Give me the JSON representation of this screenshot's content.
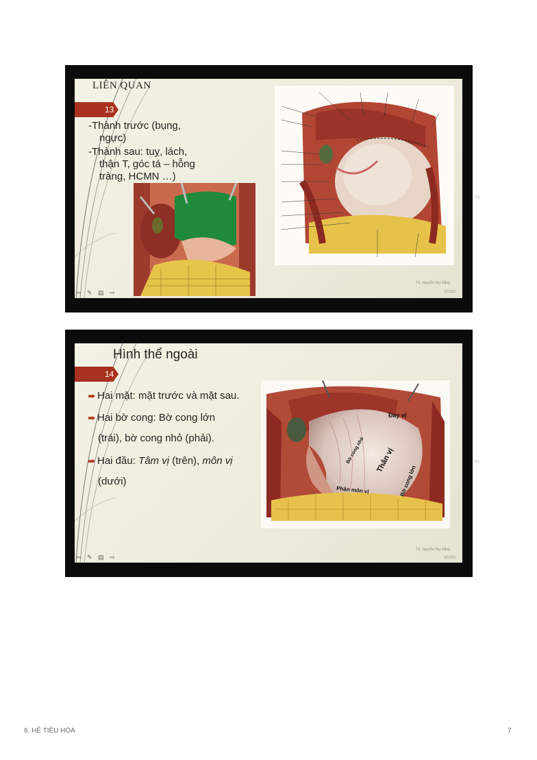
{
  "slides": [
    {
      "title": "LIÊN QUAN",
      "number": "13",
      "lines": [
        "-Thành trước (bụng,",
        "ngực)",
        "-Thành sau: tuỵ, lách,",
        "thận T, góc tá – hỗng",
        "tràng, HCMN …)"
      ],
      "credit": "TS. Nguyễn Huy Bằng",
      "date": "5/17/22",
      "edge_label": "Ng"
    },
    {
      "title": "Hình thể ngoài",
      "number": "14",
      "bullets": [
        {
          "text": "Hai mặt: mặt trước và mặt sau."
        },
        {
          "text": "Hai bờ cong: Bờ cong lớn",
          "cont": "(trái), bờ cong nhỏ  (phải)."
        },
        {
          "lead": "Hai đầu: ",
          "em1": "Tâm vị",
          "mid": " (trên), ",
          "em2": "môn vị",
          "cont": "(dưới)"
        }
      ],
      "image_labels": {
        "fundus": "Đáy vị",
        "body": "Thân vị",
        "lesser_curvature": "Bờ cong nhỏ",
        "greater_curvature": "Bờ cong lớn",
        "pyloric_part": "Phần môn vị"
      },
      "credit": "TS. Nguyễn Huy Bằng",
      "date": "5/17/22",
      "edge_label": "Ng"
    }
  ],
  "nav_icons": "⇦ ✎ ▤ ⇨",
  "footer": {
    "left": "6. HỆ TIÊU HÓA",
    "right": "7"
  }
}
